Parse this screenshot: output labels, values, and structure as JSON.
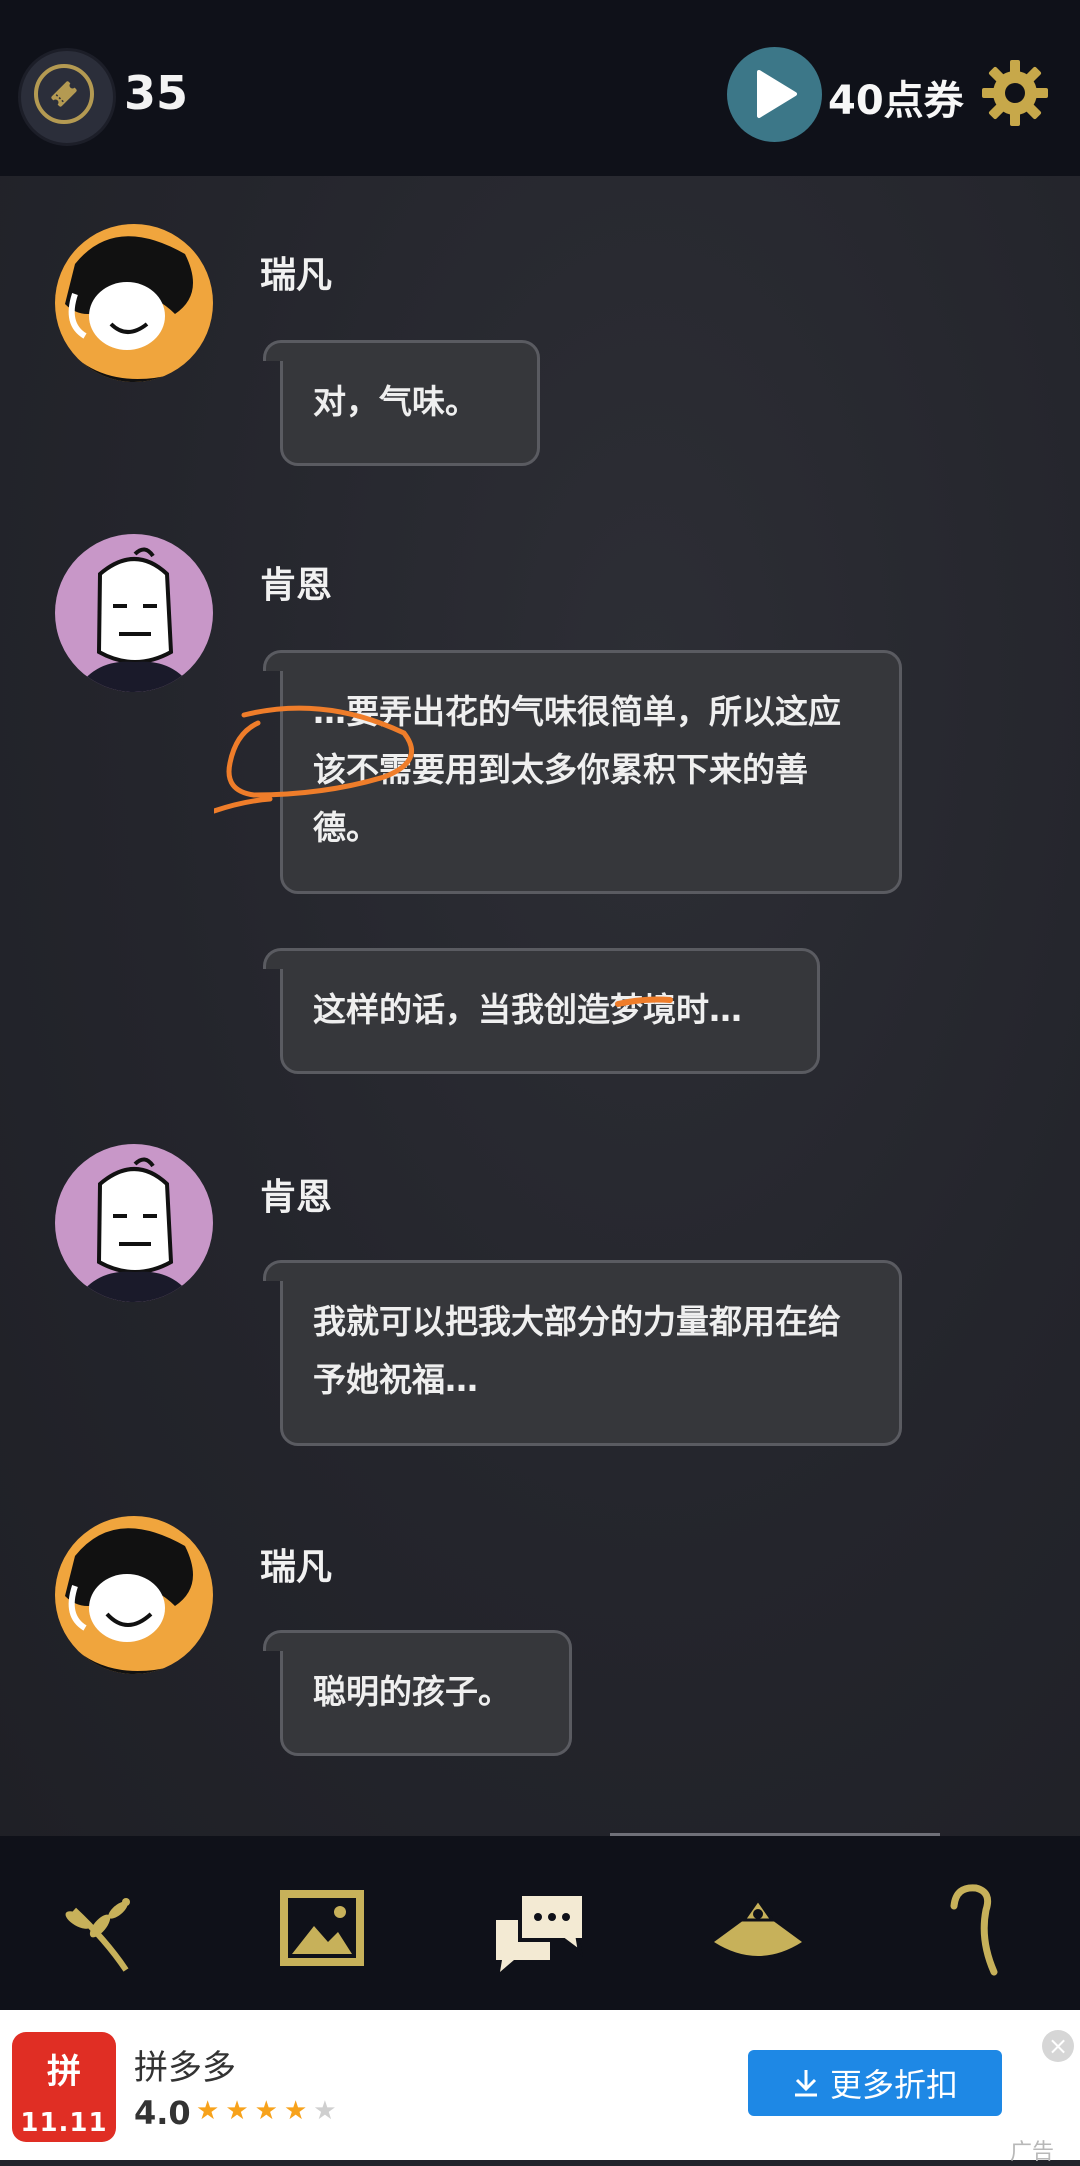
{
  "header": {
    "ticket_icon": "ticket-icon",
    "ticket_count": "35",
    "play_icon": "play-icon",
    "points_label": "40点券",
    "settings_icon": "gear-icon",
    "accent_color": "#b49a52"
  },
  "messages": [
    {
      "speaker": "瑞凡",
      "avatar": "orange",
      "bubbles": [
        "对，气味。"
      ]
    },
    {
      "speaker": "肯恩",
      "avatar": "lilac",
      "bubbles": [
        "…要弄出花的气味很简单，所以这应该不需要用到太多你累积下来的善德。",
        "这样的话，当我创造梦境时…"
      ]
    },
    {
      "speaker": "肯恩",
      "avatar": "lilac",
      "bubbles": [
        "我就可以把我大部分的力量都用在给予她祝福…"
      ]
    },
    {
      "speaker": "瑞凡",
      "avatar": "orange",
      "bubbles": [
        "聪明的孩子。"
      ]
    }
  ],
  "bottom_nav": {
    "items": [
      "branch-icon",
      "gallery-icon",
      "chat-icon",
      "hat-icon",
      "cane-icon"
    ],
    "active_index": 2,
    "icon_color": "#c7b15a"
  },
  "ad": {
    "app_name": "拼多多",
    "logo_text": "拼",
    "logo_date": "11.11",
    "rating": "4.0",
    "stars_filled": 4,
    "stars_total": 5,
    "button_label": "更多折扣",
    "tag": "广告",
    "button_color": "#1e88e5"
  }
}
